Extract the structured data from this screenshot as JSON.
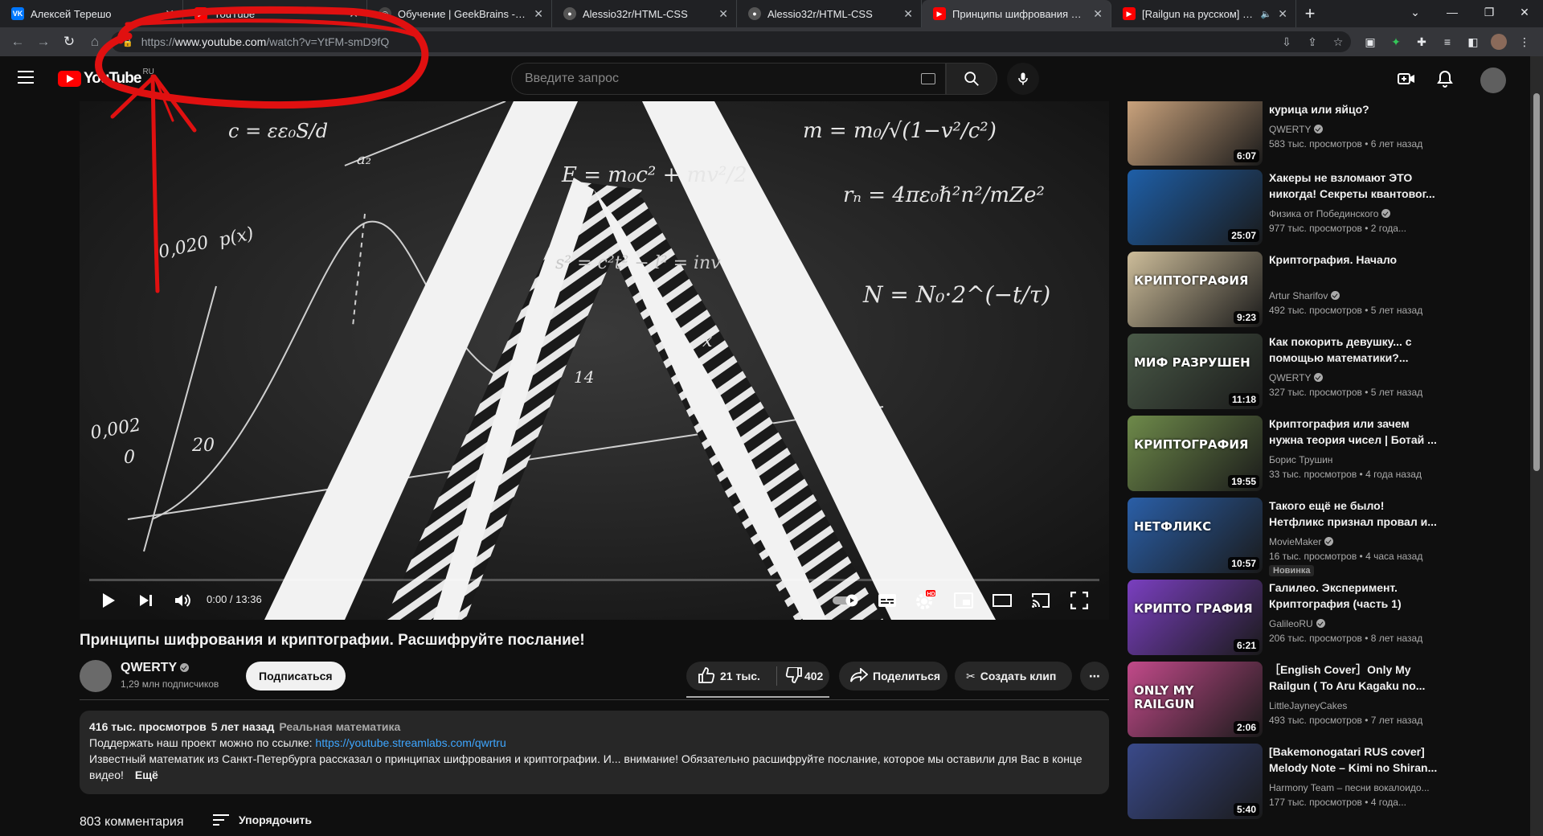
{
  "browser": {
    "tabs": [
      {
        "title": "Алексей Терешо",
        "favicon": "vk-icon",
        "color": "#0077ff",
        "letter": "VK"
      },
      {
        "title": "YouTube",
        "favicon": "youtube-icon",
        "color": "#ff0000",
        "letter": ""
      },
      {
        "title": "Обучение | GeekBrains - образ",
        "favicon": "geekbrains-icon",
        "color": "#888888",
        "letter": ""
      },
      {
        "title": "Alessio32r/HTML-CSS",
        "favicon": "github-icon",
        "color": "#555555",
        "letter": ""
      },
      {
        "title": "Alessio32r/HTML-CSS",
        "favicon": "github-icon",
        "color": "#555555",
        "letter": ""
      },
      {
        "title": "Принципы шифрования и криптографии",
        "favicon": "youtube-icon",
        "color": "#ff0000",
        "letter": ""
      },
      {
        "title": "[Railgun на русском] Final F",
        "favicon": "youtube-icon",
        "color": "#ff0000",
        "letter": ""
      }
    ],
    "url": {
      "scheme": "https://",
      "host": "www.youtube.com",
      "path": "/watch?v=YtFM-smD9fQ"
    }
  },
  "youtube": {
    "logo_text": "YouTube",
    "country_code": "RU",
    "search_placeholder": "Введите запрос"
  },
  "player": {
    "time": "0:00 / 13:36",
    "progress": 0,
    "overlay_text": [
      "c = εε₀S/d",
      "m = m₀/√(1−v²/c²)",
      "E = m₀c² + mv²/2",
      "rₙ = 4πε₀ℏ²n²/mZe²",
      "N = N₀·2^(−t/τ)",
      "0,020",
      "p(x)",
      "0,002",
      "0",
      "20",
      "14",
      "a₂",
      "x",
      "s² = c²t² − l² = inv"
    ]
  },
  "video": {
    "title": "Принципы шифрования и криптографии. Расшифруйте послание!",
    "channel": "QWERTY",
    "subscribers": "1,29 млн подписчиков",
    "subscribe_label": "Подписаться",
    "likes": "21 тыс.",
    "dislikes": "402",
    "share_label": "Поделиться",
    "clip_label": "Создать клип",
    "views": "416 тыс. просмотров",
    "age": "5 лет назад",
    "tag": "Реальная математика",
    "desc_line1": "Поддержать наш проект можно по ссылке: ",
    "desc_link": "https://youtube.streamlabs.com/qwrtru",
    "desc_line2": "Известный математик из Санкт-Петербурга рассказал о принципах шифрования и криптографии. И... внимание! Обязательно расшифруйте послание, которое мы оставили для Вас в конце видео!",
    "more_label": "Ещё",
    "comments": "803 комментария",
    "sort_label": "Упорядочить"
  },
  "recommendations": [
    {
      "title": "курица или яйцо?",
      "channel": "QWERTY",
      "verified": true,
      "meta": "583 тыс. просмотров • 6 лет назад",
      "duration": "6:07",
      "bg": "#c9a27c",
      "label": ""
    },
    {
      "title": "Хакеры не взломают ЭТО никогда! Секреты квантовог...",
      "channel": "Физика от Побединского",
      "verified": true,
      "meta": "977 тыс. просмотров • 2 года...",
      "duration": "25:07",
      "bg": "#1e5fa8",
      "label": ""
    },
    {
      "title": "Криптография. Начало",
      "channel": "Artur Sharifov",
      "verified": true,
      "meta": "492 тыс. просмотров • 5 лет назад",
      "duration": "9:23",
      "bg": "#cdbd9a",
      "label": "КРИПТОГРАФИЯ"
    },
    {
      "title": "Как покорить девушку... с помощью математики?...",
      "channel": "QWERTY",
      "verified": true,
      "meta": "327 тыс. просмотров • 5 лет назад",
      "duration": "11:18",
      "bg": "#4a5a48",
      "label": "МИФ РАЗРУШЕН"
    },
    {
      "title": "Криптография или зачем нужна теория чисел | Ботай ...",
      "channel": "Борис Трушин",
      "verified": false,
      "meta": "33 тыс. просмотров • 4 года назад",
      "duration": "19:55",
      "bg": "#6e8a4a",
      "label": "КРИПТОГРАФИЯ"
    },
    {
      "title": "Такого ещё не было! Нетфликс признал провал и...",
      "channel": "MovieMaker",
      "verified": true,
      "meta": "16 тыс. просмотров • 4 часа назад",
      "duration": "10:57",
      "bg": "#2a5fa8",
      "label": "НЕТФЛИКС",
      "badge": "Новинка"
    },
    {
      "title": "Галилео. Эксперимент. Криптография (часть 1)",
      "channel": "GalileoRU",
      "verified": true,
      "meta": "206 тыс. просмотров • 8 лет назад",
      "duration": "6:21",
      "bg": "#7a3fc0",
      "label": "КРИПТО ГРАФИЯ"
    },
    {
      "title": "［English Cover］Only My Railgun ( To Aru Kagaku no...",
      "channel": "LittleJayneyCakes",
      "verified": false,
      "meta": "493 тыс. просмотров • 7 лет назад",
      "duration": "2:06",
      "bg": "#c24a8a",
      "label": "ONLY MY RAILGUN"
    },
    {
      "title": "[Bakemonogatari RUS cover] Melody Note – Kimi no Shiran...",
      "channel": "Harmony Team – песни вокалоидо...",
      "verified": false,
      "meta": "177 тыс. просмотров • 4 года...",
      "duration": "5:40",
      "bg": "#3a4a8a",
      "label": ""
    }
  ],
  "colors": {
    "accent": "#ff0000",
    "link": "#3ea6ff",
    "annotation": "#e01010"
  }
}
